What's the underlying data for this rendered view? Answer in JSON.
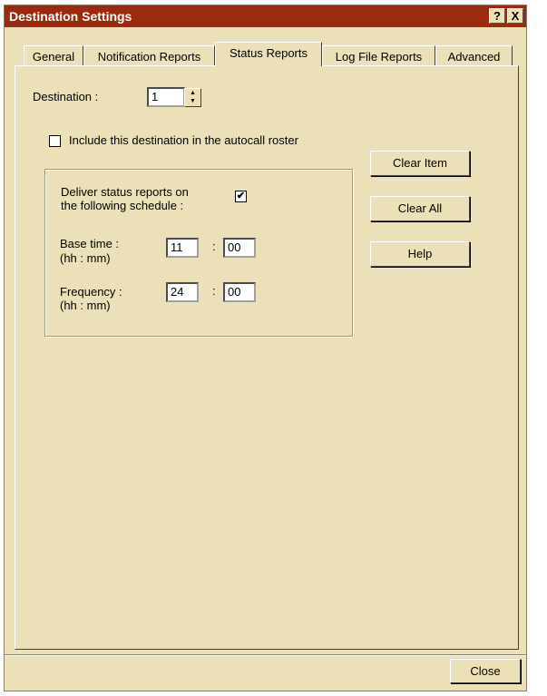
{
  "window": {
    "title": "Destination Settings",
    "help_glyph": "?",
    "close_glyph": "X"
  },
  "tabs": [
    {
      "label": "General",
      "active": false
    },
    {
      "label": "Notification Reports",
      "active": false
    },
    {
      "label": "Status Reports",
      "active": true
    },
    {
      "label": "Log File Reports",
      "active": false
    },
    {
      "label": "Advanced",
      "active": false
    }
  ],
  "destination": {
    "label": "Destination :",
    "value": "1"
  },
  "autocall": {
    "label": "Include this destination in the autocall roster",
    "checked": false
  },
  "schedule": {
    "deliver_label_line1": "Deliver status reports on",
    "deliver_label_line2": "the following schedule :",
    "deliver_checked": true,
    "check_glyph": "✔",
    "base_time": {
      "label_line1": "Base time :",
      "label_line2": "(hh : mm)",
      "hh": "11",
      "mm": "00"
    },
    "frequency": {
      "label_line1": "Frequency :",
      "label_line2": "(hh : mm)",
      "hh": "24",
      "mm": "00"
    },
    "separator": ":"
  },
  "buttons": {
    "clear_item": "Clear Item",
    "clear_all": "Clear All",
    "help": "Help",
    "close": "Close"
  },
  "colors": {
    "titlebar": "#9a2b0e",
    "dialog_bg": "#ece0b8"
  }
}
